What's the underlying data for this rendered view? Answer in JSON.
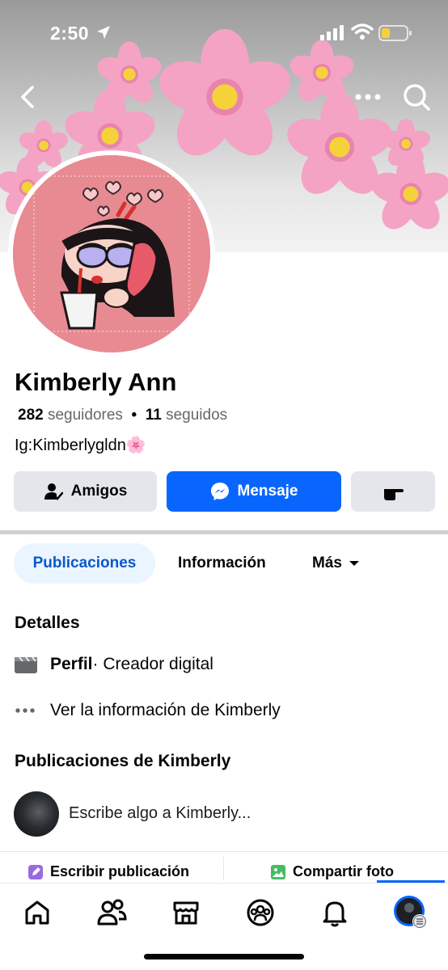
{
  "status_bar": {
    "time": "2:50"
  },
  "profile": {
    "name": "Kimberly Ann",
    "followers_count": "282",
    "followers_label": "seguidores",
    "separator": "•",
    "following_count": "11",
    "following_label": "seguidos",
    "bio": "Ig:Kimberlygldn🌸"
  },
  "actions": {
    "friends_label": "Amigos",
    "message_label": "Mensaje"
  },
  "tabs": [
    {
      "label": "Publicaciones",
      "active": true
    },
    {
      "label": "Información",
      "active": false
    },
    {
      "label": "Más",
      "active": false
    }
  ],
  "details": {
    "title": "Detalles",
    "profile_label": "Perfil",
    "profile_value": " · Creador digital",
    "info_link": "Ver la información de Kimberly"
  },
  "posts": {
    "title": "Publicaciones de Kimberly",
    "composer_placeholder": "Escribe algo a Kimberly...",
    "write_post_label": "Escribir publicación",
    "share_photo_label": "Compartir foto"
  },
  "bottom_nav": [
    {
      "icon": "home-icon"
    },
    {
      "icon": "friends-icon"
    },
    {
      "icon": "marketplace-icon"
    },
    {
      "icon": "groups-icon"
    },
    {
      "icon": "notifications-icon"
    },
    {
      "icon": "profile-menu-icon"
    }
  ],
  "colors": {
    "accent": "#0866ff",
    "tab_active_bg": "#ebf5ff",
    "tab_active_text": "#0a58ca",
    "button_gray": "#e4e6eb",
    "cover_flower": "#f4a3c4"
  }
}
